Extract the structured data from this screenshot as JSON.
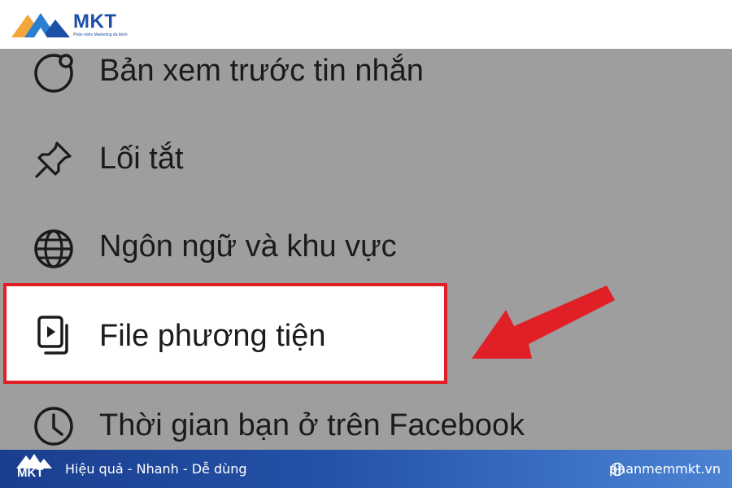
{
  "header": {
    "logo_text": "MKT",
    "logo_tagline": "Phần mềm Marketing đa kênh"
  },
  "menu": {
    "items": [
      {
        "label": "Bản xem trước tin nhắn",
        "icon": "circle-dot-icon"
      },
      {
        "label": "Lối tắt",
        "icon": "pin-icon"
      },
      {
        "label": "Ngôn ngữ và khu vực",
        "icon": "globe-icon"
      },
      {
        "label": "File phương tiện",
        "icon": "media-file-icon",
        "highlighted": true
      },
      {
        "label": "Thời gian bạn ở trên Facebook",
        "icon": "clock-icon"
      }
    ]
  },
  "annotation": {
    "arrow_color": "#e01f26",
    "highlight_color": "#e01f26"
  },
  "footer": {
    "logo_text": "MKT",
    "tagline": "Hiệu quả - Nhanh  - Dễ dùng",
    "website": "phanmemmkt.vn"
  }
}
